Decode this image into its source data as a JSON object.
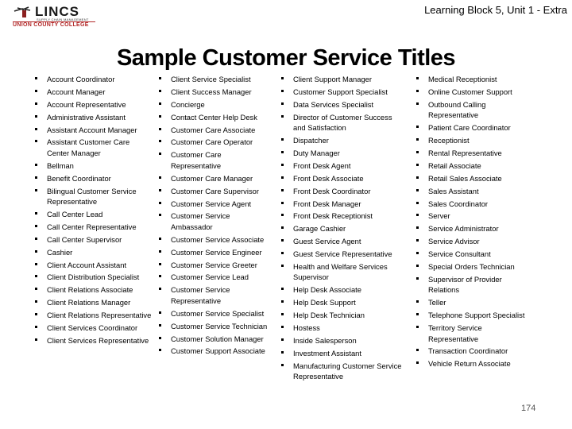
{
  "logo": {
    "name": "LINCS",
    "subtitle": "SUPPLY CHAIN MANAGEMENT",
    "college": "UNION COUNTY COLLEGE",
    "colors": {
      "word": "#1a1a1a",
      "college": "#b32929"
    }
  },
  "header": {
    "context": "Learning Block 5, Unit 1 - Extra"
  },
  "page_title": "Sample Customer Service Titles",
  "columns": [
    {
      "items": [
        "Account Coordinator",
        "Account Manager",
        "Account Representative",
        "Administrative Assistant",
        "Assistant Account Manager",
        "Assistant Customer Care Center Manager",
        "Bellman",
        "Benefit Coordinator",
        "Bilingual Customer Service Representative",
        "Call Center Lead",
        "Call Center Representative",
        "Call Center Supervisor",
        "Cashier",
        "Client Account Assistant",
        "Client Distribution Specialist",
        "Client Relations Associate",
        "Client Relations Manager",
        "Client Relations Representative",
        "Client Services Coordinator",
        "Client Services Representative"
      ]
    },
    {
      "items": [
        "Client Service Specialist",
        "Client Success Manager",
        "Concierge",
        "Contact Center Help Desk",
        "Customer Care Associate",
        "Customer Care Operator",
        "Customer Care Representative",
        "Customer Care Manager",
        "Customer Care Supervisor",
        "Customer Service Agent",
        "Customer Service Ambassador",
        "Customer Service Associate",
        "Customer Service Engineer",
        "Customer Service Greeter",
        "Customer Service Lead",
        "Customer Service Representative",
        "Customer Service Specialist",
        "Customer Service Technician",
        "Customer Solution Manager",
        "Customer Support Associate"
      ]
    },
    {
      "items": [
        "Client Support Manager",
        "Customer Support Specialist",
        "Data Services Specialist",
        "Director of Customer Success and Satisfaction",
        "Dispatcher",
        "Duty Manager",
        "Front Desk Agent",
        "Front Desk Associate",
        "Front Desk Coordinator",
        "Front Desk Manager",
        "Front Desk Receptionist",
        "Garage Cashier",
        "Guest Service Agent",
        "Guest Service Representative",
        "Health and Welfare Services Supervisor",
        "Help Desk Associate",
        "Help Desk Support",
        "Help Desk Technician",
        "Hostess",
        "Inside Salesperson",
        "Investment Assistant",
        "Manufacturing Customer Service Representative"
      ]
    },
    {
      "items": [
        "Medical Receptionist",
        "Online Customer Support",
        "Outbound Calling Representative",
        "Patient Care Coordinator",
        "Receptionist",
        "Rental Representative",
        "Retail Associate",
        "Retail Sales Associate",
        "Sales Assistant",
        "Sales Coordinator",
        "Server",
        "Service Administrator",
        "Service Advisor",
        "Service Consultant",
        "Special Orders Technician",
        "Supervisor of Provider Relations",
        "Teller",
        "Telephone Support Specialist",
        "Territory Service Representative",
        "Transaction Coordinator",
        "Vehicle Return Associate"
      ]
    }
  ],
  "page_number": "174"
}
